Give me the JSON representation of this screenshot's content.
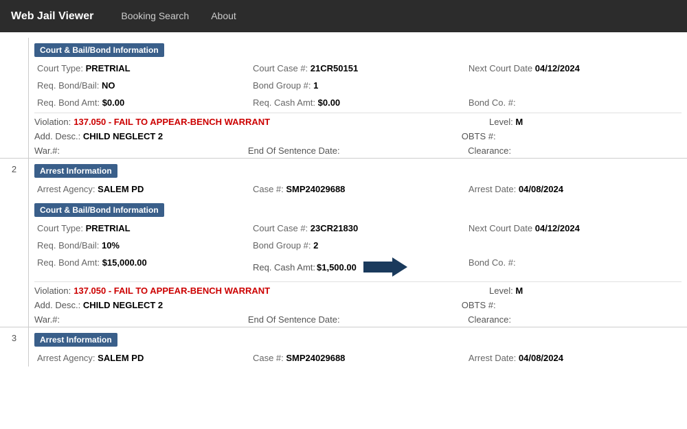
{
  "navbar": {
    "brand": "Web Jail Viewer",
    "links": [
      {
        "label": "Booking Search"
      },
      {
        "label": "About"
      }
    ]
  },
  "section1": {
    "type": "Court & Bail/Bond Information",
    "court_type_label": "Court Type:",
    "court_type_value": "PRETRIAL",
    "court_case_label": "Court Case #:",
    "court_case_value": "21CR50151",
    "next_court_label": "Next Court Date",
    "next_court_value": "04/12/2024",
    "req_bond_label": "Req. Bond/Bail:",
    "req_bond_value": "NO",
    "bond_group_label": "Bond Group #:",
    "bond_group_value": "1",
    "req_bond_amt_label": "Req. Bond Amt:",
    "req_bond_amt_value": "$0.00",
    "req_cash_label": "Req. Cash Amt:",
    "req_cash_value": "$0.00",
    "bond_co_label": "Bond Co. #:",
    "bond_co_value": "",
    "violation_label": "Violation:",
    "violation_text": "137.050 - FAIL TO APPEAR-BENCH WARRANT",
    "level_label": "Level:",
    "level_value": "M",
    "add_desc_label": "Add. Desc.:",
    "add_desc_value": "CHILD NEGLECT 2",
    "obts_label": "OBTS #:",
    "obts_value": "",
    "war_label": "War.#:",
    "war_value": "",
    "eos_label": "End Of Sentence Date:",
    "eos_value": "",
    "clearance_label": "Clearance:",
    "clearance_value": ""
  },
  "arrest1": {
    "type": "Arrest Information",
    "agency_label": "Arrest Agency:",
    "agency_value": "SALEM PD",
    "case_label": "Case #:",
    "case_value": "SMP24029688",
    "date_label": "Arrest Date:",
    "date_value": "04/08/2024"
  },
  "section2": {
    "type": "Court & Bail/Bond Information",
    "court_type_label": "Court Type:",
    "court_type_value": "PRETRIAL",
    "court_case_label": "Court Case #:",
    "court_case_value": "23CR21830",
    "next_court_label": "Next Court Date",
    "next_court_value": "04/12/2024",
    "req_bond_label": "Req. Bond/Bail:",
    "req_bond_value": "10%",
    "bond_group_label": "Bond Group #:",
    "bond_group_value": "2",
    "req_bond_amt_label": "Req. Bond Amt:",
    "req_bond_amt_value": "$15,000.00",
    "req_cash_label": "Req. Cash Amt:",
    "req_cash_value": "$1,500.00",
    "bond_co_label": "Bond Co. #:",
    "bond_co_value": "",
    "violation_label": "Violation:",
    "violation_text": "137.050 - FAIL TO APPEAR-BENCH WARRANT",
    "level_label": "Level:",
    "level_value": "M",
    "add_desc_label": "Add. Desc.:",
    "add_desc_value": "CHILD NEGLECT 2",
    "obts_label": "OBTS #:",
    "obts_value": "",
    "war_label": "War.#:",
    "war_value": "",
    "eos_label": "End Of Sentence Date:",
    "eos_value": "",
    "clearance_label": "Clearance:",
    "clearance_value": ""
  },
  "arrest2": {
    "type": "Arrest Information",
    "agency_label": "Arrest Agency:",
    "agency_value": "SALEM PD",
    "case_label": "Case #:",
    "case_value": "SMP24029688",
    "date_label": "Arrest Date:",
    "date_value": "04/08/2024"
  },
  "row_numbers": {
    "r2": "2",
    "r3": "3"
  }
}
